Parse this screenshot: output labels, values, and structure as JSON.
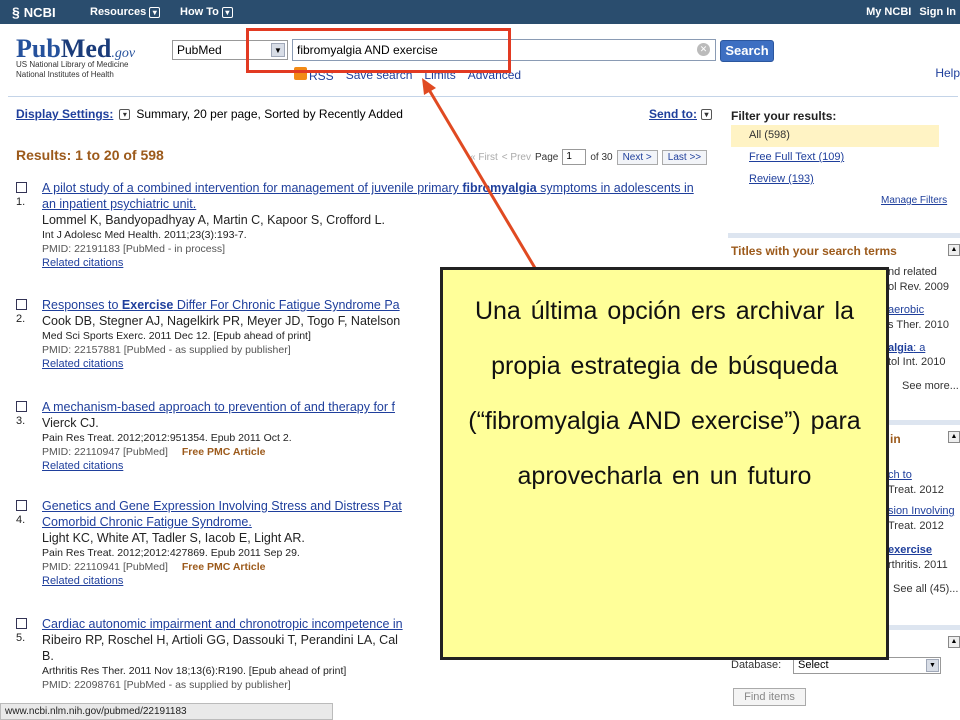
{
  "topbar": {
    "logo": "NCBI",
    "resources": "Resources",
    "howto": "How To",
    "my_ncbi": "My NCBI",
    "sign_in": "Sign In"
  },
  "header": {
    "logo_pub": "Pub",
    "logo_med": "Med",
    "logo_gov": ".gov",
    "nlm_line1": "US National Library of Medicine",
    "nlm_line2": "National Institutes of Health",
    "database": "PubMed",
    "query": "fibromyalgia AND exercise",
    "search_button": "Search",
    "rss": "RSS",
    "save_search": "Save search",
    "limits": "Limits",
    "advanced": "Advanced",
    "help": "Help"
  },
  "display": {
    "label": "Display Settings:",
    "value": "Summary, 20 per page, Sorted by Recently Added",
    "send_to": "Send to:"
  },
  "results": {
    "heading": "Results: 1 to 20 of 598",
    "pager": {
      "first": "« First",
      "prev": "< Prev",
      "page_label": "Page",
      "page": "1",
      "of": "of 30",
      "next": "Next >",
      "last": "Last >>"
    },
    "items": [
      {
        "num": "1.",
        "title_a": "A pilot study of a combined intervention for management of juvenile primary ",
        "title_b": "fibromyalgia",
        "title_c": " symptoms in adolescents in an inpatient psychiatric unit.",
        "authors": "Lommel K, Bandyopadhyay A, Martin C, Kapoor S, Crofford L.",
        "journal": "Int J Adolesc Med Health. 2011;23(3):193-7.",
        "pmid": "PMID: 22191183 [PubMed - in process]",
        "pmc": "",
        "related": "Related citations"
      },
      {
        "num": "2.",
        "title_a": "Responses to ",
        "title_b": "Exercise",
        "title_c": " Differ For Chronic Fatigue Syndrome Pa",
        "authors": "Cook DB, Stegner AJ, Nagelkirk PR, Meyer JD, Togo F, Natelson",
        "journal": "Med Sci Sports Exerc. 2011 Dec 12. [Epub ahead of print]",
        "pmid": "PMID: 22157881 [PubMed - as supplied by publisher]",
        "pmc": "",
        "related": "Related citations"
      },
      {
        "num": "3.",
        "title_a": "A mechanism-based approach to prevention of and therapy for f",
        "title_b": "",
        "title_c": "",
        "authors": "Vierck CJ.",
        "journal": "Pain Res Treat. 2012;2012:951354. Epub 2011 Oct 2.",
        "pmid": "PMID: 22110947 [PubMed]",
        "pmc": "Free PMC Article",
        "related": "Related citations"
      },
      {
        "num": "4.",
        "title_a": "Genetics and Gene Expression Involving Stress and Distress Pat",
        "title_b": "",
        "title_c": "Comorbid Chronic Fatigue Syndrome.",
        "authors": "Light KC, White AT, Tadler S, Iacob E, Light AR.",
        "journal": "Pain Res Treat. 2012;2012:427869. Epub 2011 Sep 29.",
        "pmid": "PMID: 22110941 [PubMed]",
        "pmc": "Free PMC Article",
        "related": "Related citations"
      },
      {
        "num": "5.",
        "title_a": "Cardiac autonomic impairment and chronotropic incompetence in",
        "title_b": "",
        "title_c": "",
        "authors": "Ribeiro RP, Roschel H, Artioli GG, Dassouki T, Perandini LA, Cal",
        "authors2": "B.",
        "journal": "Arthritis Res Ther. 2011 Nov 18;13(6):R190. [Epub ahead of print]",
        "pmid": "PMID: 22098761 [PubMed - as supplied by publisher]",
        "pmc": "",
        "related": "Related citations"
      }
    ]
  },
  "sidebar": {
    "filter_title": "Filter your results:",
    "filter_all": "All (598)",
    "free_full_text": "Free Full Text (109)",
    "review": "Review (193)",
    "manage_filters": "Manage Filters",
    "titles_heading": "Titles with your search terms",
    "frag": {
      "t1": "nd related",
      "t2": "ol Rev. 2009",
      "t3": "aerobic",
      "t4": "s Ther. 2010",
      "t5": "algia",
      "t5b": ": a",
      "t6": "tol Int. 2010",
      "see_more": "See more...",
      "h2": "in",
      "t7": "ch to",
      "t8": "Treat. 2012",
      "t9": "sion Involving",
      "t10": "Treat. 2012",
      "t11": "exercise",
      "t12": "rthritis. 2011",
      "see_all": "See all (45)..."
    },
    "database_label": "Database:",
    "database_value": "Select",
    "find_items": "Find items"
  },
  "statusbar": "www.ncbi.nlm.nih.gov/pubmed/22191183",
  "callout": {
    "text": "Una última opción ers archivar la propia estrategia de búsqueda (“fibromyalgia AND exercise”) para aprovecharla en un futuro"
  },
  "colors": {
    "topbar": "#2a4d6e",
    "link": "#1f3f9c",
    "heading_brown": "#9c5a1b",
    "callout_bg": "#ffff99",
    "highlight_red": "#e23a22"
  }
}
